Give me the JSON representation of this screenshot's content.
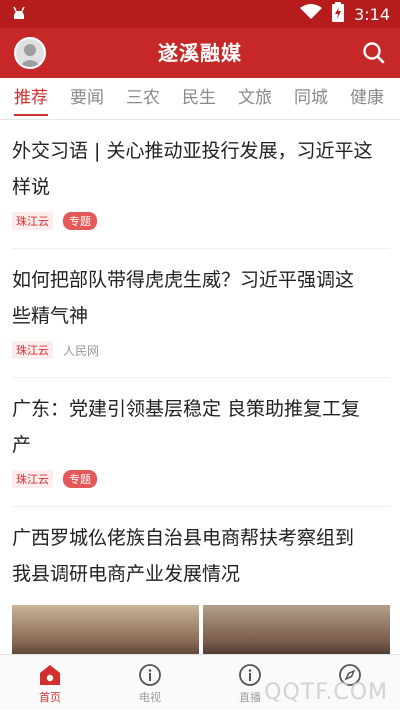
{
  "statusbar": {
    "time": "3:14"
  },
  "appbar": {
    "title": "遂溪融媒"
  },
  "tabs": [
    {
      "label": "推荐",
      "active": true
    },
    {
      "label": "要闻"
    },
    {
      "label": "三农"
    },
    {
      "label": "民生"
    },
    {
      "label": "文旅"
    },
    {
      "label": "同城"
    },
    {
      "label": "健康"
    }
  ],
  "articles": [
    {
      "headline_line1": "外交习语 | 关心推动亚投行发展，习近平这",
      "headline_line2": "样说",
      "source": "珠江云",
      "badge": "专题"
    },
    {
      "headline_line1": "如何把部队带得虎虎生威？习近平强调这",
      "headline_line2": "些精气神",
      "source": "珠江云",
      "outlet": "人民网"
    },
    {
      "headline_line1": "广东：党建引领基层稳定 良策助推复工复",
      "headline_line2": "产",
      "source": "珠江云",
      "badge": "专题"
    },
    {
      "headline_line1": "广西罗城仫佬族自治县电商帮扶考察组到",
      "headline_line2": "我县调研电商产业发展情况"
    }
  ],
  "bottomnav": [
    {
      "label": "首页",
      "icon": "home-icon",
      "active": true
    },
    {
      "label": "电视",
      "icon": "info-circle-icon"
    },
    {
      "label": "直播",
      "icon": "info-circle-icon"
    },
    {
      "label": "",
      "icon": "compass-icon"
    }
  ],
  "watermark": "QQTF.COM",
  "colors": {
    "brand_red": "#c62828",
    "accent_red": "#d32f2f"
  }
}
